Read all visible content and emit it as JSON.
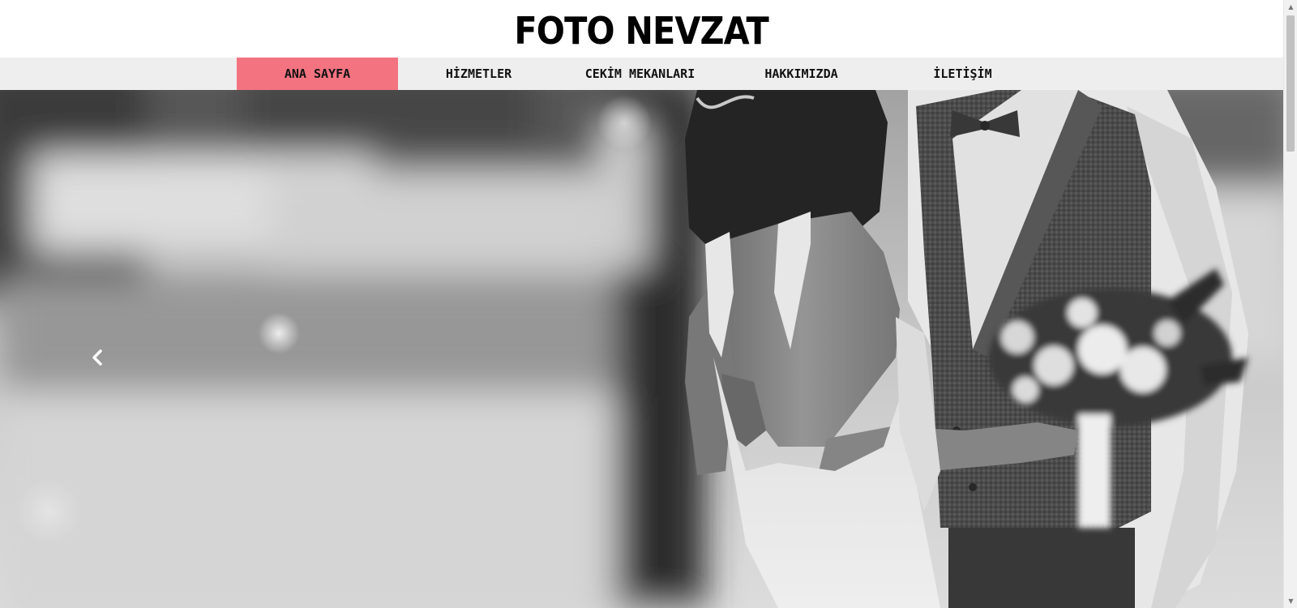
{
  "header": {
    "title": "FOTO NEVZAT"
  },
  "nav": {
    "items": [
      {
        "label": "ANA SAYFA",
        "active": true
      },
      {
        "label": "HİZMETLER",
        "active": false
      },
      {
        "label": "CEKİM MEKANLARI",
        "active": false
      },
      {
        "label": "HAKKIMIZDA",
        "active": false
      },
      {
        "label": "İLETİŞİM",
        "active": false
      }
    ],
    "active_color": "#f37381",
    "bar_color": "#eeeeee"
  },
  "hero": {
    "image": "black-and-white wedding photo of bride and groom with bouquet",
    "prev_icon": "chevron-left-icon"
  },
  "scrollbar": {
    "up_icon": "scroll-up-arrow-icon",
    "down_icon": "scroll-down-arrow-icon"
  }
}
